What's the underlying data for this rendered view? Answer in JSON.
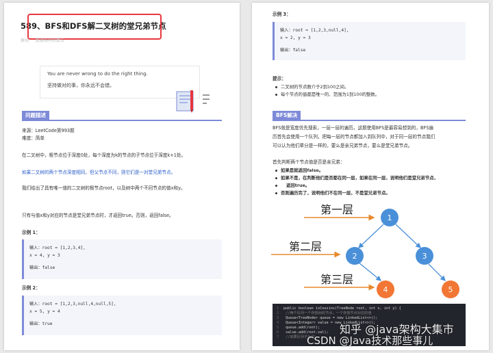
{
  "left": {
    "title": "589、BFS和DFS解二叉树的堂兄弟节点",
    "meta": [
      "原创",
      "数据结构和算法"
    ],
    "quote": {
      "en": "You are never wrong to do the right thing.",
      "zh": "坚持做对的事，你永远不会错。"
    },
    "section_problem": "问题描述",
    "source": "来源：LeetCode第993题",
    "difficulty": "难度：简单",
    "para1": "在二叉树中，根节点位于深度0处，每个深度为k的节点的子节点位于深度k+1处。",
    "para2": "如果二叉树的两个节点深度相同，但父节点不同，则它们是一对堂兄弟节点。",
    "para3": "我们给出了具有唯一值的二叉树的根节点root，以及树中两个不同节点的值x和y。",
    "para4": "只有与值x和y对应的节点是堂兄弟节点时，才返回true。否则，返回false。",
    "examples": [
      {
        "label": "示例 1：",
        "input": "输入：root = [1,2,3,4],",
        "xy": "x = 4, y = 3",
        "output": "输出：false"
      },
      {
        "label": "示例 2：",
        "input": "输入：root = [1,2,3,null,4,null,5],",
        "xy": "x = 5, y = 4",
        "output": "输出：true"
      }
    ]
  },
  "right": {
    "example3": {
      "label": "示例 3：",
      "input": "输入：root = [1,2,3,null,4],",
      "xy": "x = 2, y = 3",
      "output": "输出：false"
    },
    "hint_label": "提示：",
    "hints": [
      "二叉树的节点数介于2到100之间。",
      "每个节点的值都是唯一的、范围为1到100的整数。"
    ],
    "section_bfs": "BFS解决",
    "bfs_para": [
      "BFS就是宽度优先搜索，一层一层的遍历。这题使用BFS是最容易想到的，BFS遍",
      "历首先会使用一个队列，把每一层的节点都加入到队列中，对于同一层的节点我们",
      "可以认为他们辈分是一样的，要么是亲兄弟节点，要么是堂兄弟节点。"
    ],
    "judge_intro": "首先判断两个节点值是否是亲兄弟：",
    "judge_points": [
      "如果是就返回false。",
      "如果不是，在判断他们是否都在同一层，如果在同一层，说明他们是堂兄弟节点，",
      "返回true。",
      "否则遍历完了，说明他们不在同一层，不是堂兄弟节点。"
    ],
    "tree": {
      "levels": [
        "第一层",
        "第二层",
        "第三层"
      ],
      "nodes": [
        "1",
        "2",
        "3",
        "4",
        "5"
      ]
    },
    "code_lines": [
      {
        "n": "1",
        "t": "public boolean isCousins(TreeNode root, int x, int y) {"
      },
      {
        "n": "2",
        "t": "    //两个队列一个存放树的节点，一个存放节点对应的值"
      },
      {
        "n": "3",
        "t": "    Queue<TreeNode> queue = new LinkedList<>();"
      },
      {
        "n": "4",
        "t": "    Queue<Integer> value = new LinkedList<>();"
      },
      {
        "n": "5",
        "t": "    queue.add(root);"
      },
      {
        "n": "6",
        "t": "    value.add(root.val);"
      },
      {
        "n": "7",
        "t": "    //如果队列不为空"
      }
    ]
  },
  "watermarks": {
    "zhihu": "知乎 @java架构大集市",
    "csdn": "CSDN @Java技术那些事儿"
  },
  "colors": {
    "accent": "#7d8ad8",
    "node_blue": "#4a90d9",
    "node_orange": "#f27634",
    "arrow_orange": "#e8892c",
    "redbox": "#e8363d"
  }
}
